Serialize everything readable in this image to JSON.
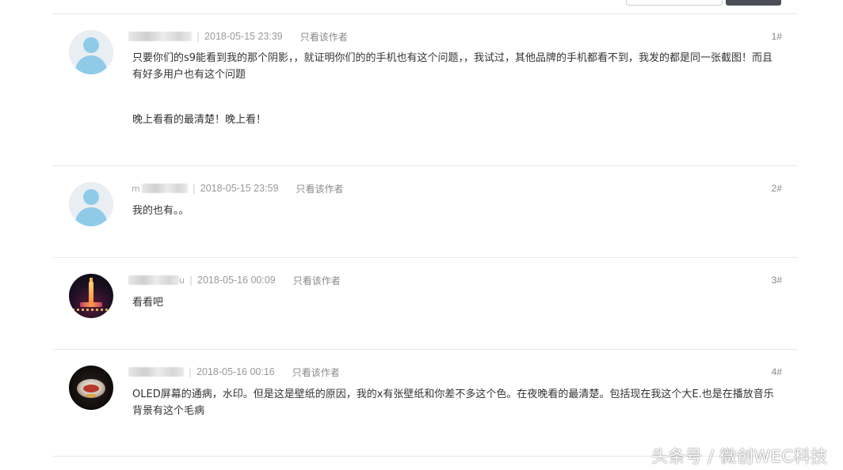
{
  "author_filter_label": "只看该作者",
  "posts": [
    {
      "name_fragment": "",
      "date": "2018-05-15 23:39",
      "floor": "1#",
      "content": [
        "只要你们的s9能看到我的那个阴影，，就证明你们的的手机也有这个问题，，我试过，其他品牌的手机都看不到，我发的都是同一张截图！而且有好多用户也有这个问题",
        "晚上看看的最清楚！晚上看！"
      ],
      "avatar_icon": "default-user-avatar"
    },
    {
      "name_fragment": "m",
      "date": "2018-05-15 23:59",
      "floor": "2#",
      "content": [
        "我的也有。。"
      ],
      "avatar_icon": "default-user-avatar"
    },
    {
      "name_fragment": "u",
      "date": "2018-05-16 00:09",
      "floor": "3#",
      "content": [
        "看看吧"
      ],
      "avatar_icon": "night-tower-avatar"
    },
    {
      "name_fragment": "",
      "date": "2018-05-16 00:16",
      "floor": "4#",
      "content": [
        "OLED屏幕的通病，水印。但是这是壁纸的原因，我的x有张壁纸和你差不多这个色。在夜晚看的最清楚。包括现在我这个大E.也是在播放音乐背景有这个毛病"
      ],
      "avatar_icon": "food-dish-avatar"
    }
  ],
  "watermark": "头条号 / 微创WEC科技"
}
